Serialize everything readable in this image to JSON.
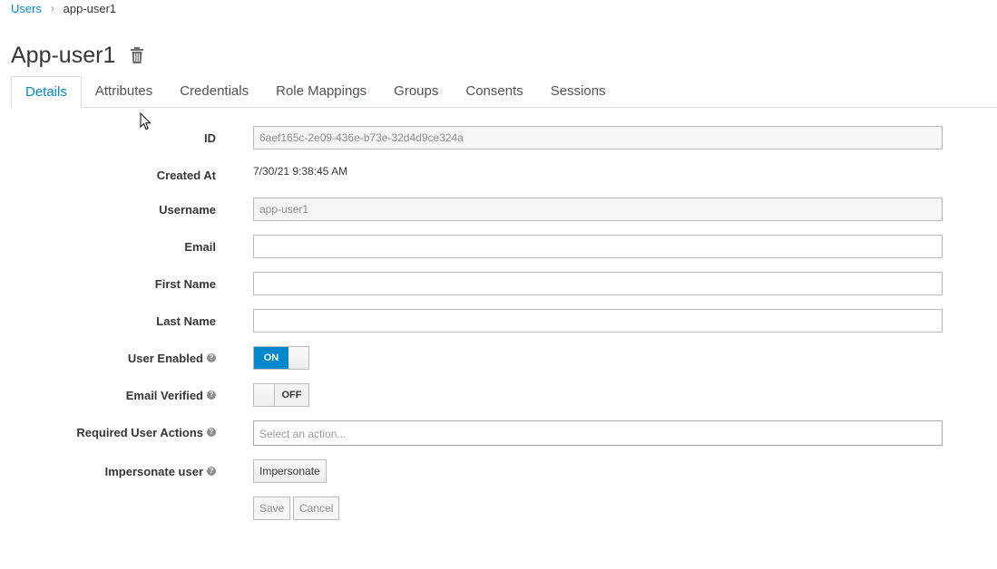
{
  "breadcrumb": {
    "parent": "Users",
    "current": "app-user1"
  },
  "page": {
    "title": "App-user1"
  },
  "tabs": [
    {
      "label": "Details",
      "active": true
    },
    {
      "label": "Attributes"
    },
    {
      "label": "Credentials"
    },
    {
      "label": "Role Mappings"
    },
    {
      "label": "Groups"
    },
    {
      "label": "Consents"
    },
    {
      "label": "Sessions"
    }
  ],
  "form": {
    "id": {
      "label": "ID",
      "value": "6aef165c-2e09-436e-b73e-32d4d9ce324a"
    },
    "created_at": {
      "label": "Created At",
      "value": "7/30/21 9:38:45 AM"
    },
    "username": {
      "label": "Username",
      "value": "app-user1"
    },
    "email": {
      "label": "Email",
      "value": ""
    },
    "first_name": {
      "label": "First Name",
      "value": ""
    },
    "last_name": {
      "label": "Last Name",
      "value": ""
    },
    "user_enabled": {
      "label": "User Enabled",
      "state": "ON"
    },
    "email_verified": {
      "label": "Email Verified",
      "state": "OFF"
    },
    "required_actions": {
      "label": "Required User Actions",
      "placeholder": "Select an action..."
    },
    "impersonate": {
      "label": "Impersonate user",
      "button": "Impersonate"
    }
  },
  "actions": {
    "save": "Save",
    "cancel": "Cancel"
  },
  "colors": {
    "accent": "#0088ce",
    "text": "#363636"
  }
}
